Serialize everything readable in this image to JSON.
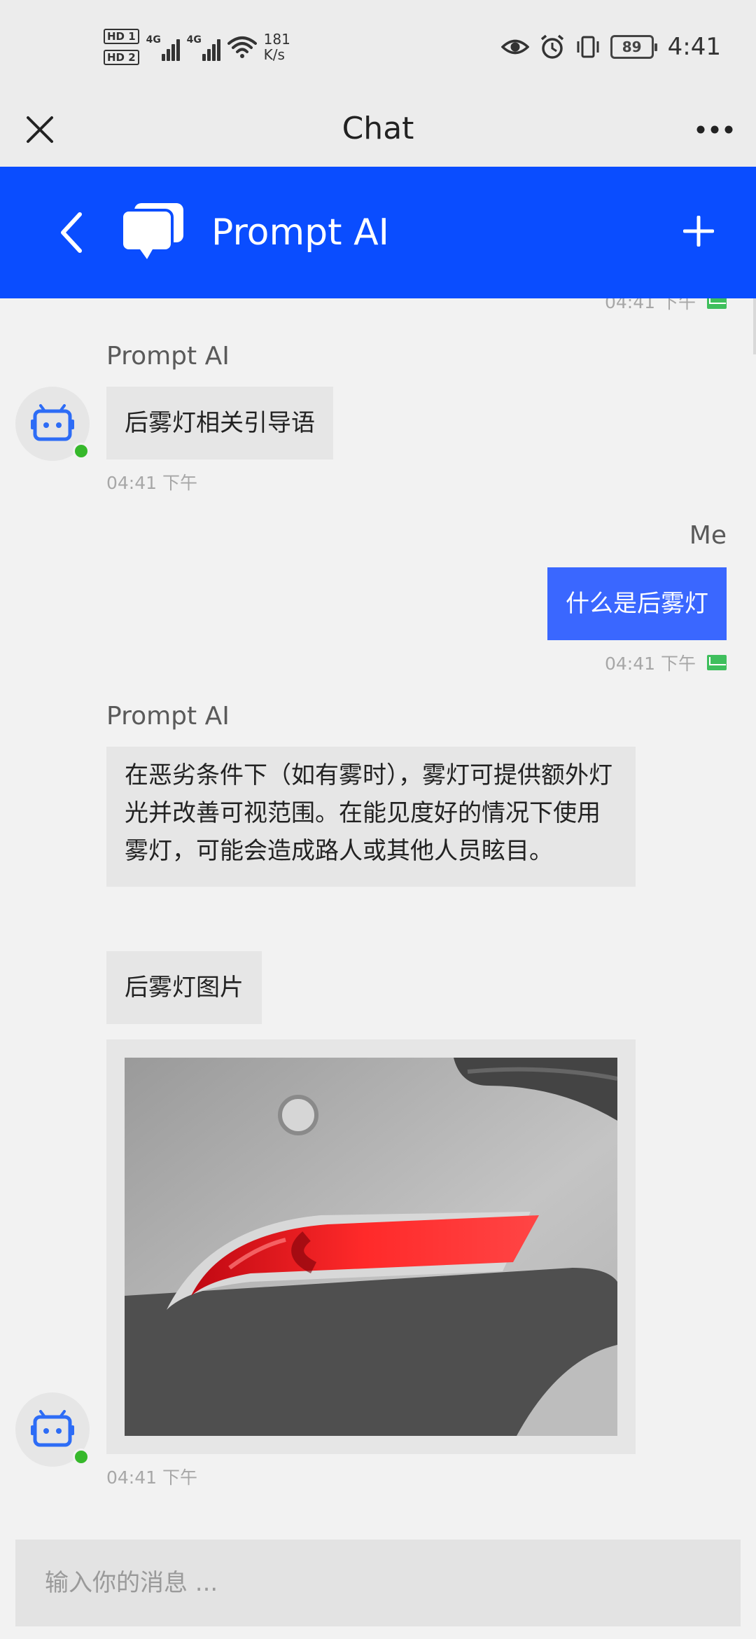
{
  "status_bar": {
    "hd1": "HD 1",
    "hd2": "HD 2",
    "net1": "4G",
    "net2": "4G",
    "speed_value": "181",
    "speed_unit": "K/s",
    "battery": "89",
    "time": "4:41"
  },
  "title_bar": {
    "title": "Chat"
  },
  "chat_header": {
    "title": "Prompt AI",
    "color": "#0a4dff"
  },
  "messages": [
    {
      "timestamp": "04:41 下午"
    },
    {
      "sender": "Prompt AI",
      "text": "后雾灯相关引导语",
      "timestamp": "04:41 下午"
    },
    {
      "sender": "Me",
      "text": "什么是后雾灯",
      "timestamp": "04:41 下午"
    },
    {
      "sender": "Prompt AI",
      "text": "在恶劣条件下（如有雾时），雾灯可提供额外灯光并改善可视范围。在能见度好的情况下使用雾灯，可能会造成路人或其他人员眩目。",
      "text2": "后雾灯图片",
      "timestamp": "04:41 下午"
    }
  ],
  "input": {
    "placeholder": "输入你的消息 ..."
  },
  "colors": {
    "accent": "#0a4dff",
    "out_bubble": "#3a67ff",
    "in_bubble": "#e6e6e6",
    "online": "#36b82b",
    "sent": "#3fbf5d"
  }
}
